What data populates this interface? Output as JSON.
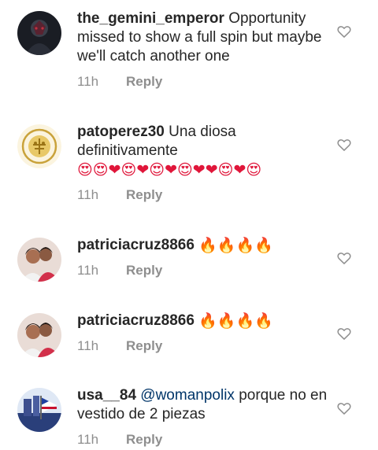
{
  "comments": [
    {
      "username": "the_gemini_emperor",
      "text": "Opportunity missed to show a full spin but maybe we'll catch another one",
      "time": "11h",
      "reply": "Reply"
    },
    {
      "username": "patoperez30",
      "text": "Una diosa definitivamente",
      "emojis": "😍😍❤😍❤😍❤😍❤❤😍❤😍",
      "time": "11h",
      "reply": "Reply"
    },
    {
      "username": "patriciacruz8866",
      "emojis": "🔥🔥🔥🔥",
      "time": "11h",
      "reply": "Reply"
    },
    {
      "username": "patriciacruz8866",
      "emojis": "🔥🔥🔥🔥",
      "time": "11h",
      "reply": "Reply"
    },
    {
      "username": "usa__84",
      "mention": "@womanpolix",
      "text": "porque no en vestido de 2 piezas",
      "time": "11h",
      "reply": "Reply"
    }
  ],
  "icons": {
    "like": "heart-outline-icon"
  },
  "colors": {
    "text": "#262626",
    "meta": "#8e8e8e",
    "mention": "#003569",
    "heart": "#e0163a"
  }
}
